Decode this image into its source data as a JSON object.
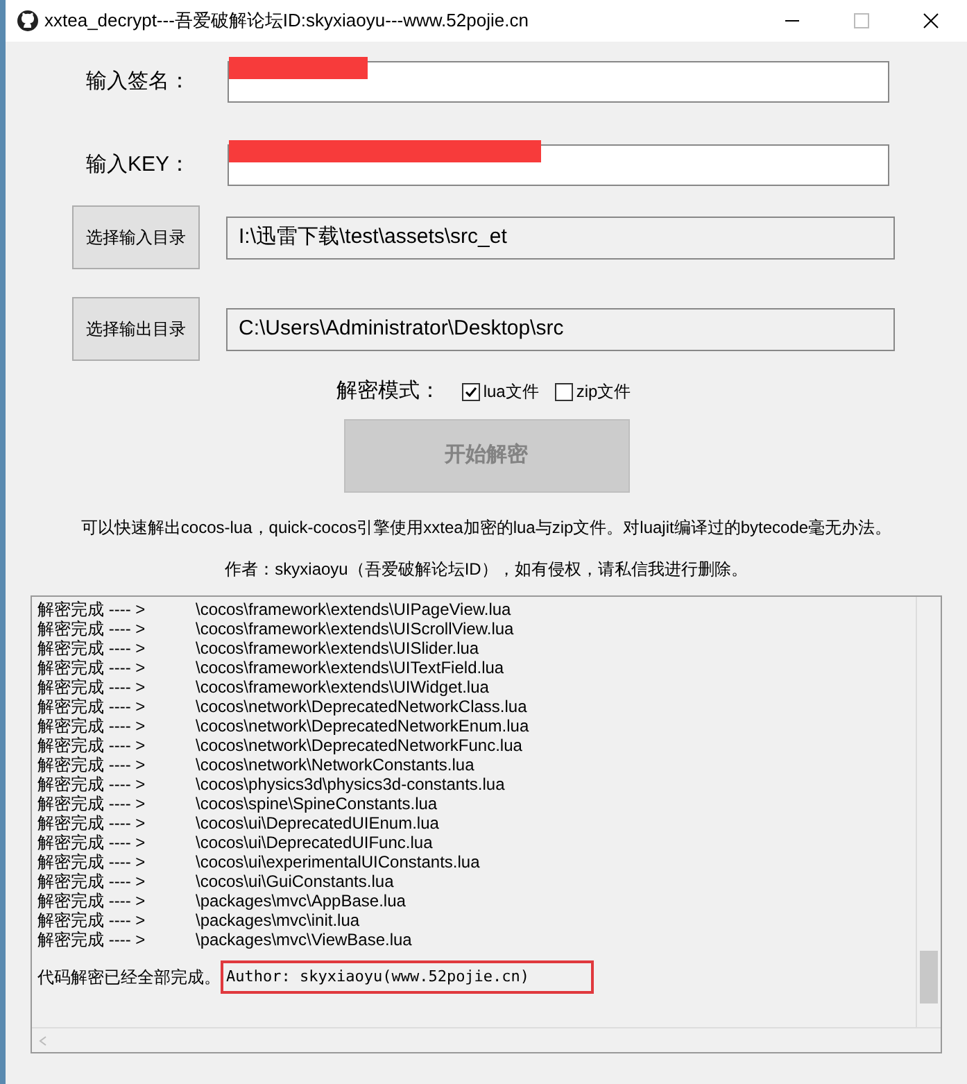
{
  "window": {
    "title": "xxtea_decrypt---吾爱破解论坛ID:skyxiaoyu---www.52pojie.cn"
  },
  "fields": [
    {
      "label": "输入签名：",
      "redacted": true
    },
    {
      "label": "输入KEY：",
      "redacted": true
    }
  ],
  "directories": [
    {
      "button": "选择输入目录",
      "value": "I:\\迅雷下载\\test\\assets\\src_et"
    },
    {
      "button": "选择输出目录",
      "value": "C:\\Users\\Administrator\\Desktop\\src"
    }
  ],
  "mode": {
    "label": "解密模式：",
    "options": [
      {
        "label": "lua文件",
        "checked": true
      },
      {
        "label": "zip文件",
        "checked": false
      }
    ]
  },
  "start_button": {
    "label": "开始解密",
    "disabled": true
  },
  "notes": [
    "可以快速解出cocos-lua，quick-cocos引擎使用xxtea加密的lua与zip文件。对luajit编译过的bytecode毫无办法。",
    "作者：skyxiaoyu（吾爱破解论坛ID），如有侵权，请私信我进行删除。"
  ],
  "log": {
    "rows": [
      {
        "status": "解密完成 ---- >",
        "path": "\\cocos\\framework\\extends\\UIPageView.lua"
      },
      {
        "status": "解密完成 ---- >",
        "path": "\\cocos\\framework\\extends\\UIScrollView.lua"
      },
      {
        "status": "解密完成 ---- >",
        "path": "\\cocos\\framework\\extends\\UISlider.lua"
      },
      {
        "status": "解密完成 ---- >",
        "path": "\\cocos\\framework\\extends\\UITextField.lua"
      },
      {
        "status": "解密完成 ---- >",
        "path": "\\cocos\\framework\\extends\\UIWidget.lua"
      },
      {
        "status": "解密完成 ---- >",
        "path": "\\cocos\\network\\DeprecatedNetworkClass.lua"
      },
      {
        "status": "解密完成 ---- >",
        "path": "\\cocos\\network\\DeprecatedNetworkEnum.lua"
      },
      {
        "status": "解密完成 ---- >",
        "path": "\\cocos\\network\\DeprecatedNetworkFunc.lua"
      },
      {
        "status": "解密完成 ---- >",
        "path": "\\cocos\\network\\NetworkConstants.lua"
      },
      {
        "status": "解密完成 ---- >",
        "path": "\\cocos\\physics3d\\physics3d-constants.lua"
      },
      {
        "status": "解密完成 ---- >",
        "path": "\\cocos\\spine\\SpineConstants.lua"
      },
      {
        "status": "解密完成 ---- >",
        "path": "\\cocos\\ui\\DeprecatedUIEnum.lua"
      },
      {
        "status": "解密完成 ---- >",
        "path": "\\cocos\\ui\\DeprecatedUIFunc.lua"
      },
      {
        "status": "解密完成 ---- >",
        "path": "\\cocos\\ui\\experimentalUIConstants.lua"
      },
      {
        "status": "解密完成 ---- >",
        "path": "\\cocos\\ui\\GuiConstants.lua"
      },
      {
        "status": "解密完成 ---- >",
        "path": "\\packages\\mvc\\AppBase.lua"
      },
      {
        "status": "解密完成 ---- >",
        "path": "\\packages\\mvc\\init.lua"
      },
      {
        "status": "解密完成 ---- >",
        "path": "\\packages\\mvc\\ViewBase.lua"
      }
    ],
    "done": "代码解密已经全部完成。",
    "author": {
      "text": "Author: skyxiaoyu(www.52pojie.cn)",
      "highlighted": true
    }
  }
}
